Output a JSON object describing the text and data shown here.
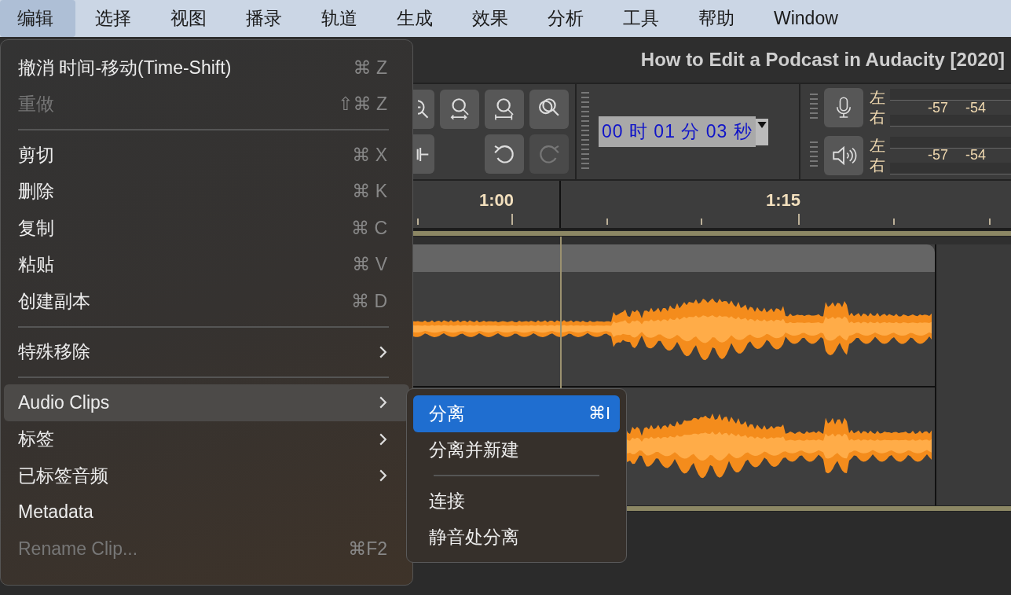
{
  "menubar": [
    {
      "label": "编辑",
      "selected": true
    },
    {
      "label": "选择",
      "selected": false
    },
    {
      "label": "视图",
      "selected": false
    },
    {
      "label": "播录",
      "selected": false
    },
    {
      "label": "轨道",
      "selected": false
    },
    {
      "label": "生成",
      "selected": false
    },
    {
      "label": "效果",
      "selected": false
    },
    {
      "label": "分析",
      "selected": false
    },
    {
      "label": "工具",
      "selected": false
    },
    {
      "label": "帮助",
      "selected": false
    },
    {
      "label": "Window",
      "selected": false
    }
  ],
  "window_title": "How to Edit a Podcast in Audacity [2020]",
  "edit_buttons": [
    {
      "kind": "undo",
      "disabled": false
    },
    {
      "kind": "redo",
      "disabled": true
    }
  ],
  "time_display": "00 时 01 分 03 秒",
  "meters": [
    {
      "kind": "record",
      "channels": [
        "左",
        "右"
      ],
      "ticks": [
        "-57",
        "-54"
      ]
    },
    {
      "kind": "playback",
      "channels": [
        "左",
        "右"
      ],
      "ticks": [
        "-57",
        "-54"
      ]
    }
  ],
  "ruler": {
    "labels": [
      "1:00",
      "1:15"
    ]
  },
  "edit_menu": [
    {
      "kind": "item",
      "label": "撤消 时间-移动(Time-Shift)",
      "shortcut": "⌘ Z",
      "disabled": false,
      "has_submenu": false,
      "selected": false
    },
    {
      "kind": "item",
      "label": "重做",
      "shortcut": "⇧⌘ Z",
      "disabled": true,
      "has_submenu": false,
      "selected": false
    },
    {
      "kind": "separator"
    },
    {
      "kind": "item",
      "label": "剪切",
      "shortcut": "⌘ X",
      "disabled": false,
      "has_submenu": false,
      "selected": false
    },
    {
      "kind": "item",
      "label": "删除",
      "shortcut": "⌘ K",
      "disabled": false,
      "has_submenu": false,
      "selected": false
    },
    {
      "kind": "item",
      "label": "复制",
      "shortcut": "⌘ C",
      "disabled": false,
      "has_submenu": false,
      "selected": false
    },
    {
      "kind": "item",
      "label": "粘贴",
      "shortcut": "⌘ V",
      "disabled": false,
      "has_submenu": false,
      "selected": false
    },
    {
      "kind": "item",
      "label": "创建副本",
      "shortcut": "⌘ D",
      "disabled": false,
      "has_submenu": false,
      "selected": false
    },
    {
      "kind": "separator"
    },
    {
      "kind": "item",
      "label": "特殊移除",
      "disabled": false,
      "has_submenu": true,
      "selected": false
    },
    {
      "kind": "separator"
    },
    {
      "kind": "item",
      "label": "Audio Clips",
      "disabled": false,
      "has_submenu": true,
      "selected": true,
      "submenu": [
        {
          "kind": "item",
          "label": "分离",
          "shortcut": "⌘I",
          "selected": true
        },
        {
          "kind": "item",
          "label": "分离并新建",
          "selected": false
        },
        {
          "kind": "separator"
        },
        {
          "kind": "item",
          "label": "连接",
          "selected": false
        },
        {
          "kind": "item",
          "label": "静音处分离",
          "selected": false
        }
      ]
    },
    {
      "kind": "item",
      "label": "标签",
      "disabled": false,
      "has_submenu": true,
      "selected": false
    },
    {
      "kind": "item",
      "label": "已标签音频",
      "disabled": false,
      "has_submenu": true,
      "selected": false
    },
    {
      "kind": "item",
      "label": "Metadata",
      "disabled": false,
      "has_submenu": false,
      "selected": false
    },
    {
      "kind": "item",
      "label": "Rename Clip...",
      "shortcut": "⌘F2",
      "disabled": true,
      "has_submenu": false,
      "selected": false
    }
  ]
}
